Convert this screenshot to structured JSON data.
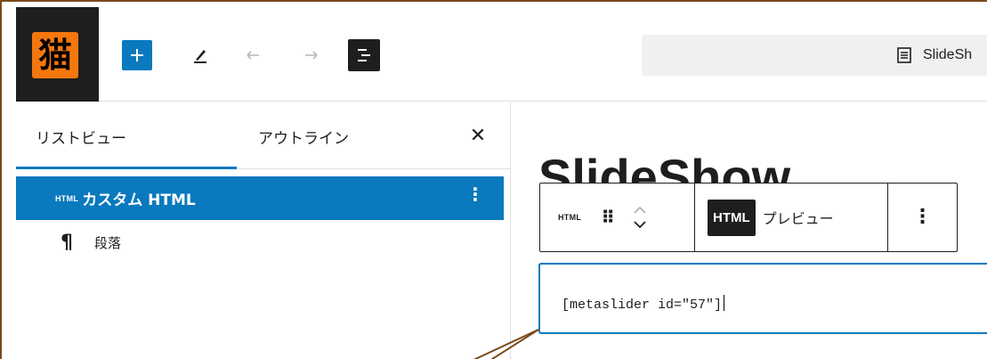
{
  "toolbar": {
    "logo_text": "猫",
    "add_icon": "plus-icon",
    "edit_icon": "pencil-icon",
    "undo_icon": "undo-icon",
    "redo_icon": "redo-icon",
    "list_view_icon": "list-view-icon",
    "document_icon": "document-icon",
    "document_title": "SlideSh"
  },
  "sidebar": {
    "tabs": [
      {
        "label": "リストビュー",
        "active": true
      },
      {
        "label": "アウトライン",
        "active": false
      }
    ],
    "close_icon": "close-icon",
    "close_glyph": "✕",
    "blocks": [
      {
        "tag": "HTML",
        "label": "カスタム HTML",
        "selected": true,
        "menu_glyph": "⋮"
      },
      {
        "icon": "paragraph-icon",
        "glyph": "¶",
        "label": "段落",
        "selected": false
      }
    ]
  },
  "canvas": {
    "post_title": "SlideShow",
    "block_toolbar": {
      "block_type_tag": "HTML",
      "drag_glyph": "⠿",
      "html_button": "HTML",
      "preview_button": "プレビュー",
      "options_glyph": "⋮"
    },
    "editor_value": "[metaslider id=\"57\"]"
  },
  "colors": {
    "accent": "#0a79be",
    "dark": "#1e1e1e",
    "logo": "#f4770e",
    "frame": "#7b4a1c"
  }
}
